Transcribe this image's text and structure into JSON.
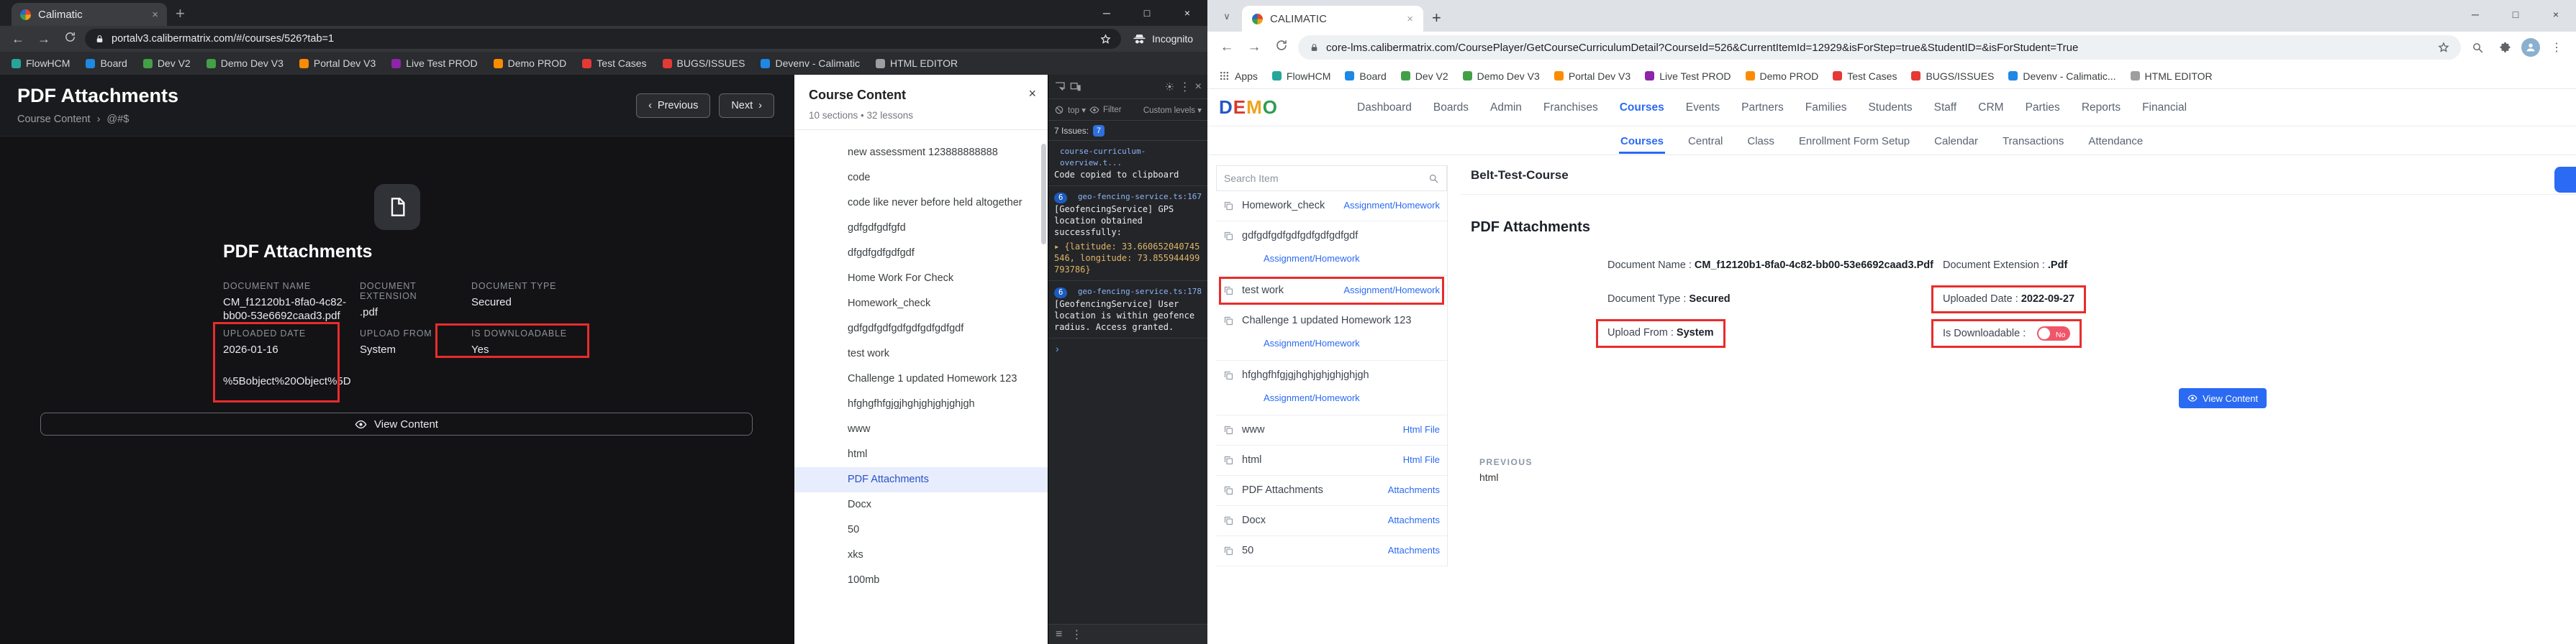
{
  "annotation_color": "#e82c2c",
  "accent_blue": "#2b6af3",
  "left_window": {
    "tab_title": "Calimatic",
    "url": "portalv3.calibermatrix.com/#/courses/526?tab=1",
    "incognito_label": "Incognito",
    "bookmarks": [
      {
        "label": "FlowHCM",
        "color": "#26a69a"
      },
      {
        "label": "Board",
        "color": "#1e88e5"
      },
      {
        "label": "Dev V2",
        "color": "#43a047"
      },
      {
        "label": "Demo Dev V3",
        "color": "#43a047"
      },
      {
        "label": "Portal Dev V3",
        "color": "#fb8c00"
      },
      {
        "label": "Live Test PROD",
        "color": "#8e24aa"
      },
      {
        "label": "Demo PROD",
        "color": "#fb8c00"
      },
      {
        "label": "Test Cases",
        "color": "#e53935"
      },
      {
        "label": "BUGS/ISSUES",
        "color": "#e53935"
      },
      {
        "label": "Devenv - Calimatic",
        "color": "#1e88e5"
      },
      {
        "label": "HTML EDITOR",
        "color": "#9e9e9e"
      }
    ],
    "page": {
      "title": "PDF Attachments",
      "breadcrumb_parent": "Course Content",
      "breadcrumb_sep": "›",
      "breadcrumb_current": "@#$",
      "prev_button": "Previous",
      "next_button": "Next",
      "detail_heading": "PDF Attachments",
      "fields": [
        {
          "label": "DOCUMENT NAME",
          "value": "CM_f12120b1-8fa0-4c82-bb00-53e6692caad3.pdf"
        },
        {
          "label": "DOCUMENT EXTENSION",
          "value": ".pdf"
        },
        {
          "label": "DOCUMENT TYPE",
          "value": "Secured"
        },
        {
          "label": "UPLOADED DATE",
          "value": "2026-01-16"
        },
        {
          "label": "UPLOAD FROM",
          "value": "System"
        },
        {
          "label": "IS DOWNLOADABLE",
          "value": "Yes"
        }
      ],
      "encoded_object_text": "%5Bobject%20Object%5D",
      "view_content_button": "View Content"
    },
    "course_panel": {
      "title": "Course Content",
      "subtitle": "10 sections • 32 lessons",
      "selected_lesson": "PDF Attachments",
      "lessons": [
        "new assessment 123888888888",
        "code",
        "code like never before held altogether",
        "gdfgdfgdfgfd",
        "dfgdfgdfgdfgdf",
        "Home Work For Check",
        "Homework_check",
        "gdfgdfgdfgdfgdfgdfgdfgdf",
        "test work",
        "Challenge 1 updated Homework 123",
        "hfghgfhfgjgjhghjghjghjghjgh",
        "www",
        "html",
        "PDF Attachments",
        "Docx",
        "50",
        "xks",
        "100mb"
      ]
    },
    "devtools": {
      "context_dropdown": "top",
      "filter_label": "Filter",
      "levels_dropdown": "Custom levels",
      "issues_label": "7 Issues:",
      "issues_count": "7",
      "prompt": "›",
      "console_entries": [
        {
          "source": "course-curriculum-overview.t...",
          "text": "Code copied to clipboard"
        },
        {
          "badge": "6",
          "source": "geo-fencing-service.ts:167",
          "text": "[GeofencingService] GPS location obtained successfully:",
          "object_preview": "{latitude: 33.660652040745546, longitude: 73.855944499793786}"
        },
        {
          "badge": "6",
          "source": "geo-fencing-service.ts:178",
          "text": "[GeofencingService] User location is within geofence radius. Access granted."
        }
      ]
    }
  },
  "right_window": {
    "tab_title": "CALIMATIC",
    "url": "core-lms.calibermatrix.com/CoursePlayer/GetCourseCurriculumDetail?CourseId=526&CurrentItemId=12929&isForStep=true&StudentID=&isForStudent=True",
    "apps_label": "Apps",
    "bookmarks": [
      {
        "label": "FlowHCM",
        "color": "#26a69a"
      },
      {
        "label": "Board",
        "color": "#1e88e5"
      },
      {
        "label": "Dev V2",
        "color": "#43a047"
      },
      {
        "label": "Demo Dev V3",
        "color": "#43a047"
      },
      {
        "label": "Portal Dev V3",
        "color": "#fb8c00"
      },
      {
        "label": "Live Test PROD",
        "color": "#8e24aa"
      },
      {
        "label": "Demo PROD",
        "color": "#fb8c00"
      },
      {
        "label": "Test Cases",
        "color": "#e53935"
      },
      {
        "label": "BUGS/ISSUES",
        "color": "#e53935"
      },
      {
        "label": "Devenv - Calimatic...",
        "color": "#1e88e5"
      },
      {
        "label": "HTML EDITOR",
        "color": "#9e9e9e"
      }
    ],
    "app": {
      "logo_letters": [
        {
          "char": "D",
          "color": "#2456c5"
        },
        {
          "char": "E",
          "color": "#d8392c"
        },
        {
          "char": "M",
          "color": "#f0a21c"
        },
        {
          "char": "O",
          "color": "#2d9e50"
        }
      ],
      "nav": [
        "Dashboard",
        "Boards",
        "Admin",
        "Franchises",
        "Courses",
        "Events",
        "Partners",
        "Families",
        "Students",
        "Staff",
        "CRM",
        "Parties",
        "Reports",
        "Financial"
      ],
      "active_nav": "Courses",
      "subnav": [
        "Courses",
        "Central",
        "Class",
        "Enrollment Form Setup",
        "Calendar",
        "Transactions",
        "Attendance"
      ],
      "active_subnav": "Courses"
    },
    "sidebar": {
      "search_placeholder": "Search Item",
      "items": [
        {
          "title": "Homework_check",
          "category": "Assignment/Homework",
          "layout": "inline",
          "highlighted": false
        },
        {
          "title": "gdfgdfgdfgdfgdfgdfgdfgdf",
          "category": "Assignment/Homework",
          "layout": "below",
          "highlighted": false
        },
        {
          "title": "test work",
          "category": "Assignment/Homework",
          "layout": "inline",
          "highlighted": true
        },
        {
          "title": "Challenge 1 updated Homework 123",
          "category": "Assignment/Homework",
          "layout": "below",
          "highlighted": false
        },
        {
          "title": "hfghgfhfgjgjhghjghjghjghjgh",
          "category": "Assignment/Homework",
          "layout": "below",
          "highlighted": false
        },
        {
          "title": "www",
          "category": "Html File",
          "layout": "inline",
          "highlighted": false
        },
        {
          "title": "html",
          "category": "Html File",
          "layout": "inline",
          "highlighted": false
        },
        {
          "title": "PDF Attachments",
          "category": "Attachments",
          "layout": "inline",
          "highlighted": false
        },
        {
          "title": "Docx",
          "category": "Attachments",
          "layout": "inline",
          "highlighted": false
        },
        {
          "title": "50",
          "category": "Attachments",
          "layout": "inline",
          "highlighted": false
        }
      ]
    },
    "main": {
      "course_title": "Belt-Test-Course",
      "heading": "PDF Attachments",
      "field_separator": ":",
      "fields": [
        {
          "label": "Document Name",
          "value": "CM_f12120b1-8fa0-4c82-bb00-53e6692caad3.Pdf",
          "highlighted": false
        },
        {
          "label": "Document Extension",
          "value": ".Pdf",
          "highlighted": false
        },
        {
          "label": "Document Type",
          "value": "Secured",
          "highlighted": false
        },
        {
          "label": "Uploaded Date",
          "value": "2022-09-27",
          "highlighted": true
        },
        {
          "label": "Upload From",
          "value": "System",
          "highlighted": true
        },
        {
          "label": "Is Downloadable",
          "toggle_label": "No",
          "highlighted": true
        }
      ],
      "view_content_button": "View Content",
      "previous_label": "PREVIOUS",
      "previous_item": "html"
    }
  }
}
